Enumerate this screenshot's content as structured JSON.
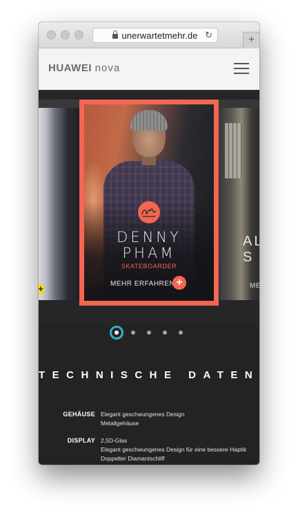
{
  "browser": {
    "url": "unerwartetmehr.de",
    "new_tab": "+"
  },
  "header": {
    "logo_brand": "HUAWEI",
    "logo_model": "nova"
  },
  "carousel": {
    "left_plus": "+",
    "main_card": {
      "first_name": "DENNY",
      "last_name": "PHAM",
      "role": "SKATEBOARDER",
      "more_label": "MEHR ERFAHREN",
      "plus": "+"
    },
    "right_card": {
      "name_line1": "AL",
      "name_line2": "S",
      "more_label": "ME"
    },
    "total_slides": 5,
    "active_slide": 1
  },
  "tech": {
    "title": "TECHNISCHE DATEN",
    "specs": [
      {
        "label": "GEHÄUSE",
        "lines": [
          "Elegant geschwungenes Design",
          "Metallgehäuse"
        ]
      },
      {
        "label": "DISPLAY",
        "lines": [
          "2,5D-Glas",
          "Elegant geschwungenes Design für eine bessere Haptik",
          "Doppelter Diamantschliff"
        ]
      }
    ]
  },
  "colors": {
    "accent": "#f36652",
    "active_dot": "#34b3c1",
    "left_plus": "#ffdd00",
    "page_bg": "#232326"
  }
}
